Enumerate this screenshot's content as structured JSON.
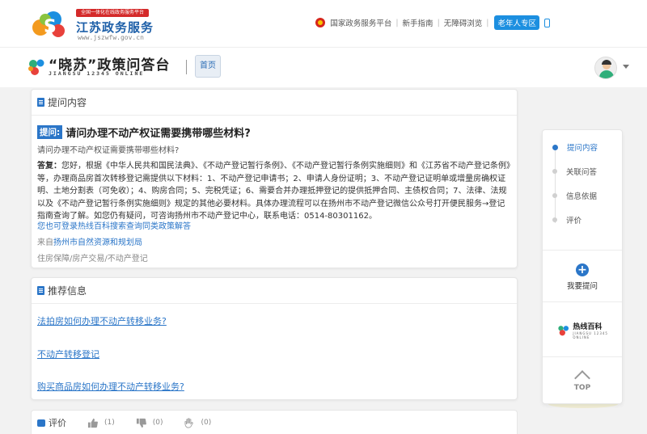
{
  "header": {
    "logo_badge": "全国一体化在线政务服务平台",
    "logo_title": "江苏政务服务",
    "logo_url": "www.jszwfw.gov.cn",
    "links": [
      "国家政务服务平台",
      "新手指南",
      "无障碍浏览"
    ],
    "elder_mode": "老年人专区"
  },
  "subheader": {
    "brand_title": "“晓苏”政策问答台",
    "brand_sub": "JIANGSU 12345 ONLINE",
    "home_label": "首页"
  },
  "question_card": {
    "section_title": "提问内容",
    "tag": "提问:",
    "title": "请问办理不动产权证需要携带哪些材料?",
    "description": "请问办理不动产权证需要携带哪些材料?",
    "answer_label": "答复：",
    "answer": "您好，根据《中华人民共和国民法典》、《不动产登记暂行条例》、《不动产登记暂行条例实施细则》和《江苏省不动产登记条例》等，办理商品房首次转移登记需提供以下材料：1、不动产登记申请书；2、申请人身份证明；3、不动产登记证明单或增量房确权证明、土地分割表（可免收）；4、购房合同；5、完税凭证；6、需要合并办理抵押登记的提供抵押合同、主债权合同；7、法律、法规以及《不动产登记暂行条例实施细则》规定的其他必要材料。具体办理流程可以在扬州市不动产登记微信公众号打开便民服务→登记指南查询了解。如您仍有疑问，可咨询扬州市不动产登记中心，联系电话：0514-80301162。",
    "search_link": "您也可登录热线百科搜索查询同类政策解答",
    "source_prefix": "来自",
    "source_org": "扬州市自然资源和规划局",
    "tags": "住房保障/房产交易/不动产登记"
  },
  "recommend_card": {
    "section_title": "推荐信息",
    "items": [
      "法拍房如何办理不动产转移业务?",
      "不动产转移登记",
      "购买商品房如何办理不动产转移业务?"
    ]
  },
  "evaluation": {
    "label": "评价",
    "like_count": "(1)",
    "dislike_count": "(0)",
    "clap_count": "(0)"
  },
  "right_nav": {
    "items": [
      "提问内容",
      "关联问答",
      "信息依据",
      "评价"
    ],
    "ask_label": "我要提问",
    "hotline_title": "热线百科",
    "hotline_sub": "JIANGSU 12345 ONLINE",
    "top_label": "TOP"
  },
  "colors": {
    "accent": "#2b76c8",
    "badge_red": "#d42a2a",
    "elder_blue": "#1c8fe0"
  }
}
